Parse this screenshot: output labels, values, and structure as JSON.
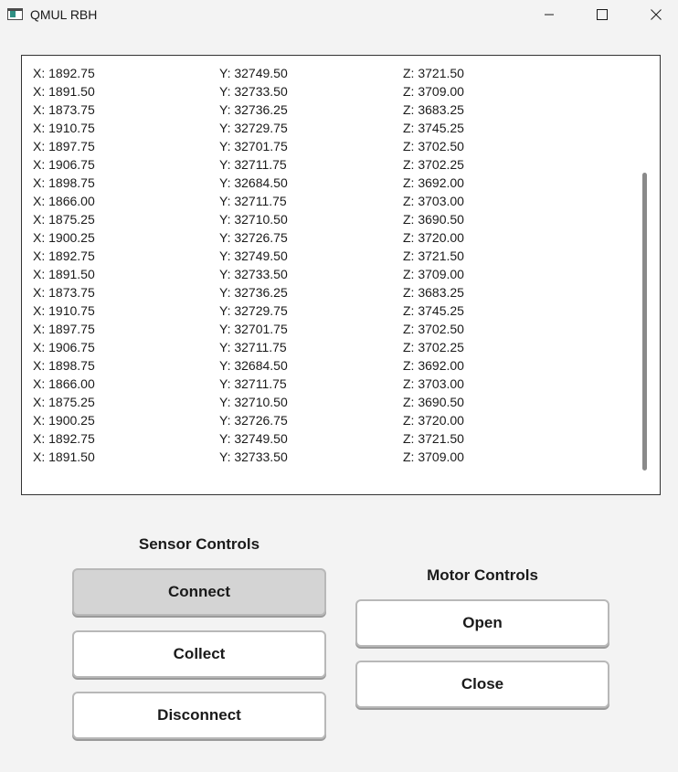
{
  "window": {
    "title": "QMUL RBH",
    "icon": "app-window-icon"
  },
  "log": {
    "rows": [
      {
        "x": "X: 1892.75",
        "y": "Y: 32749.50",
        "z": "Z: 3721.50"
      },
      {
        "x": "X: 1891.50",
        "y": "Y: 32733.50",
        "z": "Z: 3709.00"
      },
      {
        "x": "X: 1873.75",
        "y": "Y: 32736.25",
        "z": "Z: 3683.25"
      },
      {
        "x": "X: 1910.75",
        "y": "Y: 32729.75",
        "z": "Z: 3745.25"
      },
      {
        "x": "X: 1897.75",
        "y": "Y: 32701.75",
        "z": "Z: 3702.50"
      },
      {
        "x": "X: 1906.75",
        "y": "Y: 32711.75",
        "z": "Z: 3702.25"
      },
      {
        "x": "X: 1898.75",
        "y": "Y: 32684.50",
        "z": "Z: 3692.00"
      },
      {
        "x": "X: 1866.00",
        "y": "Y: 32711.75",
        "z": "Z: 3703.00"
      },
      {
        "x": "X: 1875.25",
        "y": "Y: 32710.50",
        "z": "Z: 3690.50"
      },
      {
        "x": "X: 1900.25",
        "y": "Y: 32726.75",
        "z": "Z: 3720.00"
      },
      {
        "x": "X: 1892.75",
        "y": "Y: 32749.50",
        "z": "Z: 3721.50"
      },
      {
        "x": "X: 1891.50",
        "y": "Y: 32733.50",
        "z": "Z: 3709.00"
      },
      {
        "x": "X: 1873.75",
        "y": "Y: 32736.25",
        "z": "Z: 3683.25"
      },
      {
        "x": "X: 1910.75",
        "y": "Y: 32729.75",
        "z": "Z: 3745.25"
      },
      {
        "x": "X: 1897.75",
        "y": "Y: 32701.75",
        "z": "Z: 3702.50"
      },
      {
        "x": "X: 1906.75",
        "y": "Y: 32711.75",
        "z": "Z: 3702.25"
      },
      {
        "x": "X: 1898.75",
        "y": "Y: 32684.50",
        "z": "Z: 3692.00"
      },
      {
        "x": "X: 1866.00",
        "y": "Y: 32711.75",
        "z": "Z: 3703.00"
      },
      {
        "x": "X: 1875.25",
        "y": "Y: 32710.50",
        "z": "Z: 3690.50"
      },
      {
        "x": "X: 1900.25",
        "y": "Y: 32726.75",
        "z": "Z: 3720.00"
      },
      {
        "x": "X: 1892.75",
        "y": "Y: 32749.50",
        "z": "Z: 3721.50"
      },
      {
        "x": "X: 1891.50",
        "y": "Y: 32733.50",
        "z": "Z: 3709.00"
      }
    ]
  },
  "sensor_controls": {
    "heading": "Sensor Controls",
    "connect_label": "Connect",
    "collect_label": "Collect",
    "disconnect_label": "Disconnect"
  },
  "motor_controls": {
    "heading": "Motor Controls",
    "open_label": "Open",
    "close_label": "Close"
  },
  "colors": {
    "window_bg": "#f3f3f3",
    "panel_bg": "#ffffff",
    "pressed_button_bg": "#d4d4d4",
    "icon_accent": "#2f8f83"
  }
}
